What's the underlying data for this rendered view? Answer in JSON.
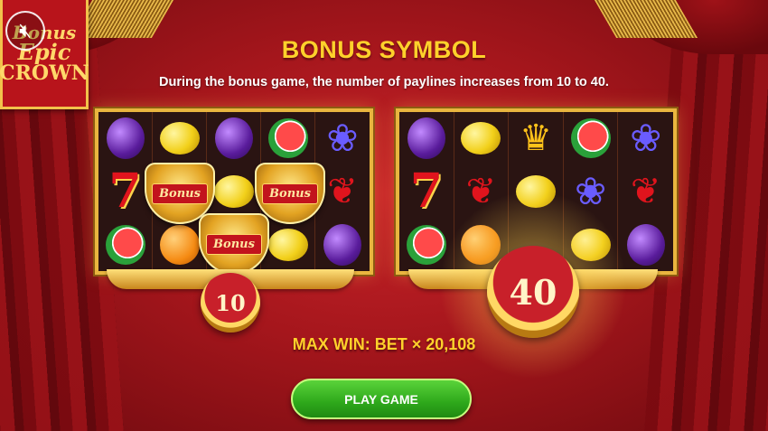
{
  "logo": {
    "line1": "Bonus",
    "line2": "Epic",
    "line3": "CROWN"
  },
  "mute_icon": "speaker-muted-icon",
  "title": "BONUS SYMBOL",
  "subtitle": "During the bonus game, the number of paylines increases from 10 to 40.",
  "left_reel": {
    "symbols": [
      "plum",
      "lemon",
      "plum",
      "watermelon",
      "grape",
      "seven",
      "",
      "lemon",
      "",
      "cherry",
      "watermelon",
      "orange",
      "",
      "lemon",
      "plum"
    ],
    "bonus_label": "Bonus",
    "paylines": "10"
  },
  "right_reel": {
    "symbols": [
      "plum",
      "lemon",
      "crown",
      "watermelon",
      "grape",
      "seven",
      "cherry",
      "lemon",
      "grape",
      "cherry",
      "watermelon",
      "orange",
      "",
      "lemon",
      "plum"
    ],
    "paylines": "40"
  },
  "max_win": "MAX WIN: BET × 20,108",
  "play_button": "PLAY GAME",
  "colors": {
    "title": "#ffd12b",
    "button": "#2ea81b",
    "background": "#a5161c"
  }
}
